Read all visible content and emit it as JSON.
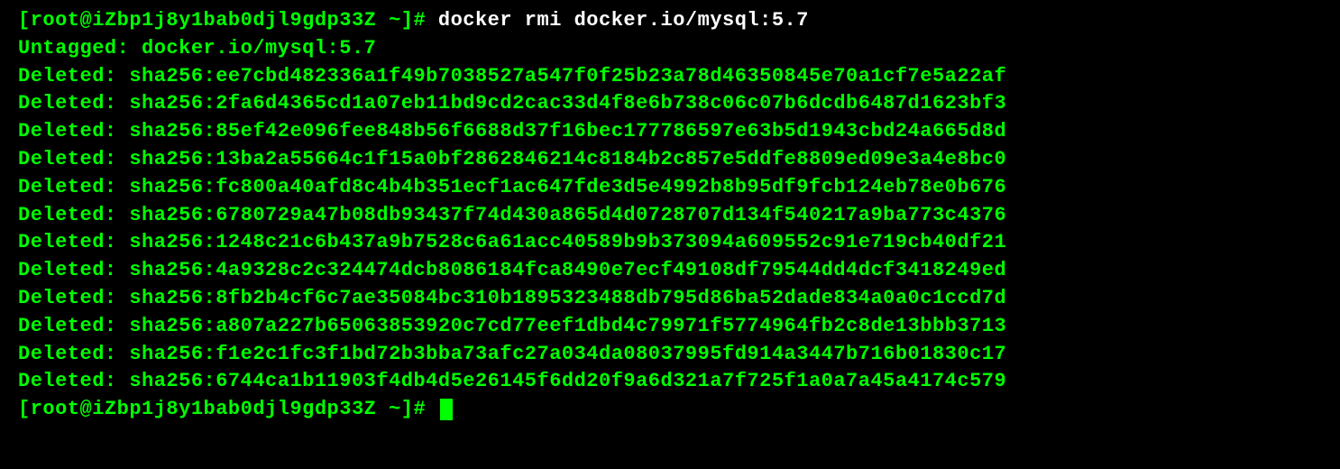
{
  "prompt1": {
    "user_host": "[root@iZbp1j8y1bab0djl9gdp33Z ~]# ",
    "command": "docker rmi docker.io/mysql:5.7"
  },
  "output": {
    "untagged": "Untagged: docker.io/mysql:5.7",
    "deleted_lines": [
      "Deleted: sha256:ee7cbd482336a1f49b7038527a547f0f25b23a78d46350845e70a1cf7e5a22af",
      "Deleted: sha256:2fa6d4365cd1a07eb11bd9cd2cac33d4f8e6b738c06c07b6dcdb6487d1623bf3",
      "Deleted: sha256:85ef42e096fee848b56f6688d37f16bec177786597e63b5d1943cbd24a665d8d",
      "Deleted: sha256:13ba2a55664c1f15a0bf2862846214c8184b2c857e5ddfe8809ed09e3a4e8bc0",
      "Deleted: sha256:fc800a40afd8c4b4b351ecf1ac647fde3d5e4992b8b95df9fcb124eb78e0b676",
      "Deleted: sha256:6780729a47b08db93437f74d430a865d4d0728707d134f540217a9ba773c4376",
      "Deleted: sha256:1248c21c6b437a9b7528c6a61acc40589b9b373094a609552c91e719cb40df21",
      "Deleted: sha256:4a9328c2c324474dcb8086184fca8490e7ecf49108df79544dd4dcf3418249ed",
      "Deleted: sha256:8fb2b4cf6c7ae35084bc310b1895323488db795d86ba52dade834a0a0c1ccd7d",
      "Deleted: sha256:a807a227b65063853920c7cd77eef1dbd4c79971f5774964fb2c8de13bbb3713",
      "Deleted: sha256:f1e2c1fc3f1bd72b3bba73afc27a034da08037995fd914a3447b716b01830c17",
      "Deleted: sha256:6744ca1b11903f4db4d5e26145f6dd20f9a6d321a7f725f1a0a7a45a4174c579"
    ]
  },
  "prompt2": {
    "user_host": "[root@iZbp1j8y1bab0djl9gdp33Z ~]# "
  }
}
